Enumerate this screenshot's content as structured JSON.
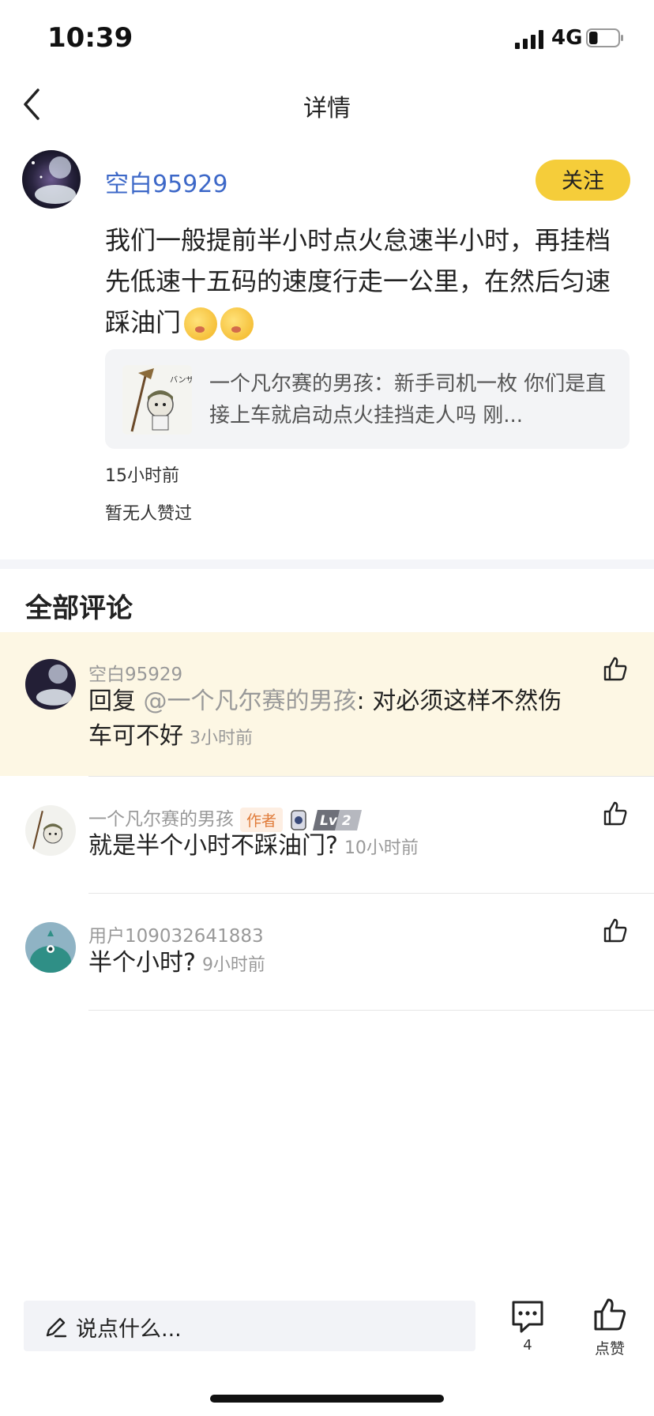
{
  "status_bar": {
    "time": "10:39",
    "network": "4G",
    "battery_level": 0.3
  },
  "nav": {
    "title": "详情"
  },
  "post": {
    "username": "空白95929",
    "follow_label": "关注",
    "text": "我们一般提前半小时点火怠速半小时，再挂档先低速十五码的速度行走一公里，在然后匀速踩油门",
    "emoji_icons": [
      "sweat-kiss-emoji",
      "sweat-kiss-emoji"
    ],
    "quote": {
      "thumb_text": "バンザイ板栽",
      "text": "一个凡尔赛的男孩：新手司机一枚 你们是直接上车就启动点火挂挡走人吗 刚..."
    },
    "time": "15小时前",
    "likes_text": "暂无人赞过"
  },
  "comments_section": {
    "title": "全部评论",
    "comments": [
      {
        "username": "空白95929",
        "reply_prefix": "回复 ",
        "mention": "@一个凡尔赛的男孩",
        "text": ": 对必须这样不然伤车可不好",
        "time": "3小时前",
        "highlighted": true
      },
      {
        "username": "一个凡尔赛的男孩",
        "author_badge": "作者",
        "level": "Lv 2",
        "text": "就是半个小时不踩油门?",
        "time": "10小时前"
      },
      {
        "username": "用户109032641883",
        "text": "半个小时?",
        "time": "9小时前"
      }
    ]
  },
  "bottom_bar": {
    "input_placeholder": "说点什么...",
    "comment_count": "4",
    "like_label": "点赞"
  },
  "colors": {
    "accent_blue": "#3d68c8",
    "follow_yellow": "#f5cd3a",
    "highlight_bg": "#fdf7e4",
    "author_badge": "#e07b39"
  }
}
